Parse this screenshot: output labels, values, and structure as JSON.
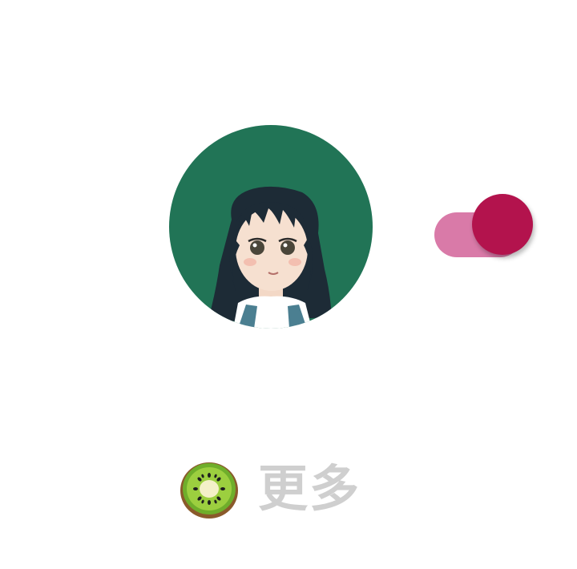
{
  "avatar": {
    "icon": "girl-avatar",
    "background_color": "#217456"
  },
  "toggle": {
    "state": "on",
    "track_color": "#d97aa8",
    "thumb_color": "#b3134d"
  },
  "more": {
    "icon": "kiwi-icon",
    "label": "更多",
    "label_color": "#cfcfcf"
  }
}
